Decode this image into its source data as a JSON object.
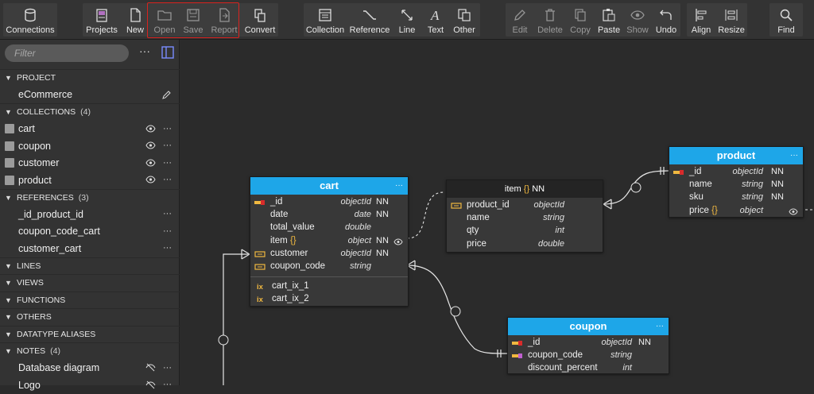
{
  "toolbar": {
    "connections": "Connections",
    "projects": "Projects",
    "new": "New",
    "open": "Open",
    "save": "Save",
    "report": "Report",
    "convert": "Convert",
    "collection": "Collection",
    "reference": "Reference",
    "line": "Line",
    "text": "Text",
    "other": "Other",
    "edit": "Edit",
    "delete": "Delete",
    "copy": "Copy",
    "paste": "Paste",
    "show": "Show",
    "undo": "Undo",
    "align": "Align",
    "resize": "Resize",
    "find": "Find"
  },
  "sidebar": {
    "filter_placeholder": "Filter",
    "more": "···",
    "project_header": "PROJECT",
    "project_name": "eCommerce",
    "collections_header": "COLLECTIONS",
    "collections_count": "(4)",
    "collections": [
      "cart",
      "coupon",
      "customer",
      "product"
    ],
    "references_header": "REFERENCES",
    "references_count": "(3)",
    "references": [
      "_id_product_id",
      "coupon_code_cart",
      "customer_cart"
    ],
    "lines_header": "LINES",
    "views_header": "VIEWS",
    "functions_header": "FUNCTIONS",
    "others_header": "OTHERS",
    "aliases_header": "DATATYPE ALIASES",
    "notes_header": "NOTES",
    "notes_count": "(4)",
    "notes": [
      "Database diagram",
      "Logo"
    ]
  },
  "entities": {
    "cart": {
      "title": "cart",
      "dots": "···",
      "fields": [
        {
          "name": "_id",
          "type": "objectId",
          "nn": "NN"
        },
        {
          "name": "date",
          "type": "date",
          "nn": "NN"
        },
        {
          "name": "total_value",
          "type": "double",
          "nn": ""
        },
        {
          "name": "item",
          "brace": "{}",
          "type": "object",
          "nn": "NN"
        },
        {
          "name": "customer",
          "type": "objectId",
          "nn": "NN"
        },
        {
          "name": "coupon_code",
          "type": "string",
          "nn": ""
        }
      ],
      "indexes": [
        "cart_ix_1",
        "cart_ix_2"
      ],
      "ix_label": "ix"
    },
    "item": {
      "title": "item",
      "brace": "{}",
      "nn": "NN",
      "fields": [
        {
          "name": "product_id",
          "type": "objectId"
        },
        {
          "name": "name",
          "type": "string"
        },
        {
          "name": "qty",
          "type": "int"
        },
        {
          "name": "price",
          "type": "double"
        }
      ]
    },
    "product": {
      "title": "product",
      "dots": "···",
      "fields": [
        {
          "name": "_id",
          "type": "objectId",
          "nn": "NN"
        },
        {
          "name": "name",
          "type": "string",
          "nn": "NN"
        },
        {
          "name": "sku",
          "type": "string",
          "nn": "NN"
        },
        {
          "name": "price",
          "brace": "{}",
          "type": "object",
          "nn": ""
        }
      ]
    },
    "coupon": {
      "title": "coupon",
      "dots": "···",
      "fields": [
        {
          "name": "_id",
          "type": "objectId",
          "nn": "NN"
        },
        {
          "name": "coupon_code",
          "type": "string",
          "nn": ""
        },
        {
          "name": "discount_percent",
          "type": "int",
          "nn": ""
        }
      ]
    }
  },
  "colors": {
    "accent": "#1ea6e8",
    "highlight": "#d9231f",
    "key": "#f0b840"
  }
}
